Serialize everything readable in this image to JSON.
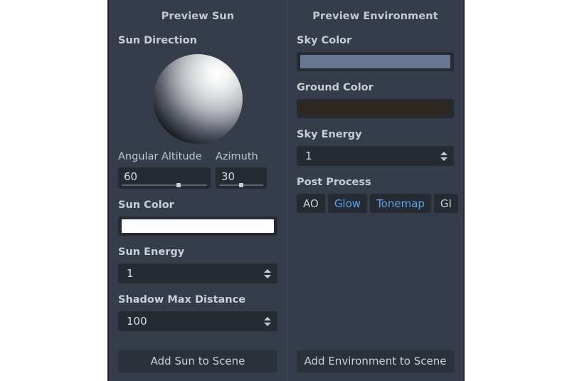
{
  "theme": {
    "panel_bg": "#363d4a",
    "field_bg": "#262b33",
    "button_bg": "#2b313a",
    "text": "#c9cdd5",
    "accent": "#5aa6e8",
    "divider": "#434a57",
    "outer_bg": "#ffffff"
  },
  "sun": {
    "title": "Preview Sun",
    "direction_label": "Sun Direction",
    "direction_widget_name": "sun-direction-sphere",
    "angular_altitude": {
      "label": "Angular Altitude",
      "value": "60",
      "slider_percent": 67
    },
    "azimuth": {
      "label": "Azimuth",
      "value": "30",
      "slider_percent": 50
    },
    "sun_color": {
      "label": "Sun Color",
      "value": "#ffffff"
    },
    "sun_energy": {
      "label": "Sun Energy",
      "value": "1",
      "spinner_icon": "up-down-chevron-icon"
    },
    "shadow_max_distance": {
      "label": "Shadow Max Distance",
      "value": "100",
      "spinner_icon": "up-down-chevron-icon"
    },
    "add_button": "Add Sun to Scene"
  },
  "environment": {
    "title": "Preview Environment",
    "sky_color": {
      "label": "Sky Color",
      "value": "#657691"
    },
    "ground_color": {
      "label": "Ground Color",
      "value": "#2e2720"
    },
    "sky_energy": {
      "label": "Sky Energy",
      "value": "1",
      "spinner_icon": "up-down-chevron-icon"
    },
    "post_process": {
      "label": "Post Process",
      "buttons": [
        {
          "label": "AO",
          "active": false
        },
        {
          "label": "Glow",
          "active": true
        },
        {
          "label": "Tonemap",
          "active": true
        },
        {
          "label": "GI",
          "active": false
        }
      ]
    },
    "add_button": "Add Environment to Scene"
  }
}
